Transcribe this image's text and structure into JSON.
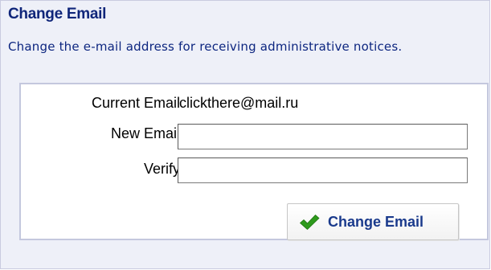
{
  "panel": {
    "title": "Change Email",
    "description": "Change the e-mail address for receiving administrative notices."
  },
  "form": {
    "current_email_label": "Current Email",
    "current_email_value": "clickthere@mail.ru",
    "new_email_label": "New Email",
    "new_email_value": "",
    "verify_label": "Verify",
    "verify_value": "",
    "submit_label": "Change Email",
    "submit_icon": "checkmark-icon"
  },
  "colors": {
    "title": "#10267a",
    "panel_background": "#eef0f8",
    "check_green": "#2e9a1c"
  }
}
